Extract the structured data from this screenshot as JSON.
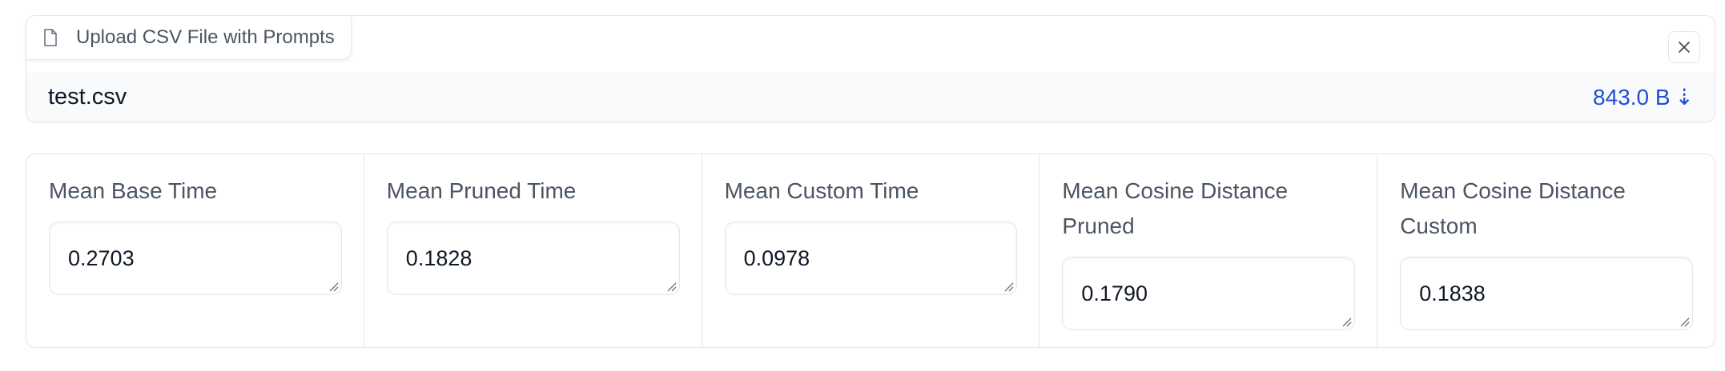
{
  "upload": {
    "label": "Upload CSV File with Prompts",
    "file_icon": "file-icon",
    "close_icon": "close-icon",
    "file_name": "test.csv",
    "file_size": "843.0 B",
    "download_glyph": "⇣",
    "download_icon": "download-icon"
  },
  "metrics": [
    {
      "label": "Mean Base Time",
      "value": "0.2703"
    },
    {
      "label": "Mean Pruned Time",
      "value": "0.1828"
    },
    {
      "label": "Mean Custom Time",
      "value": "0.0978"
    },
    {
      "label": "Mean Cosine Distance Pruned",
      "value": "0.1790"
    },
    {
      "label": "Mean Cosine Distance Custom",
      "value": "0.1838"
    }
  ],
  "colors": {
    "border": "#e5e7eb",
    "label_text": "#4b5563",
    "link_blue": "#1d4ed8",
    "file_row_bg": "#f9fafb"
  }
}
